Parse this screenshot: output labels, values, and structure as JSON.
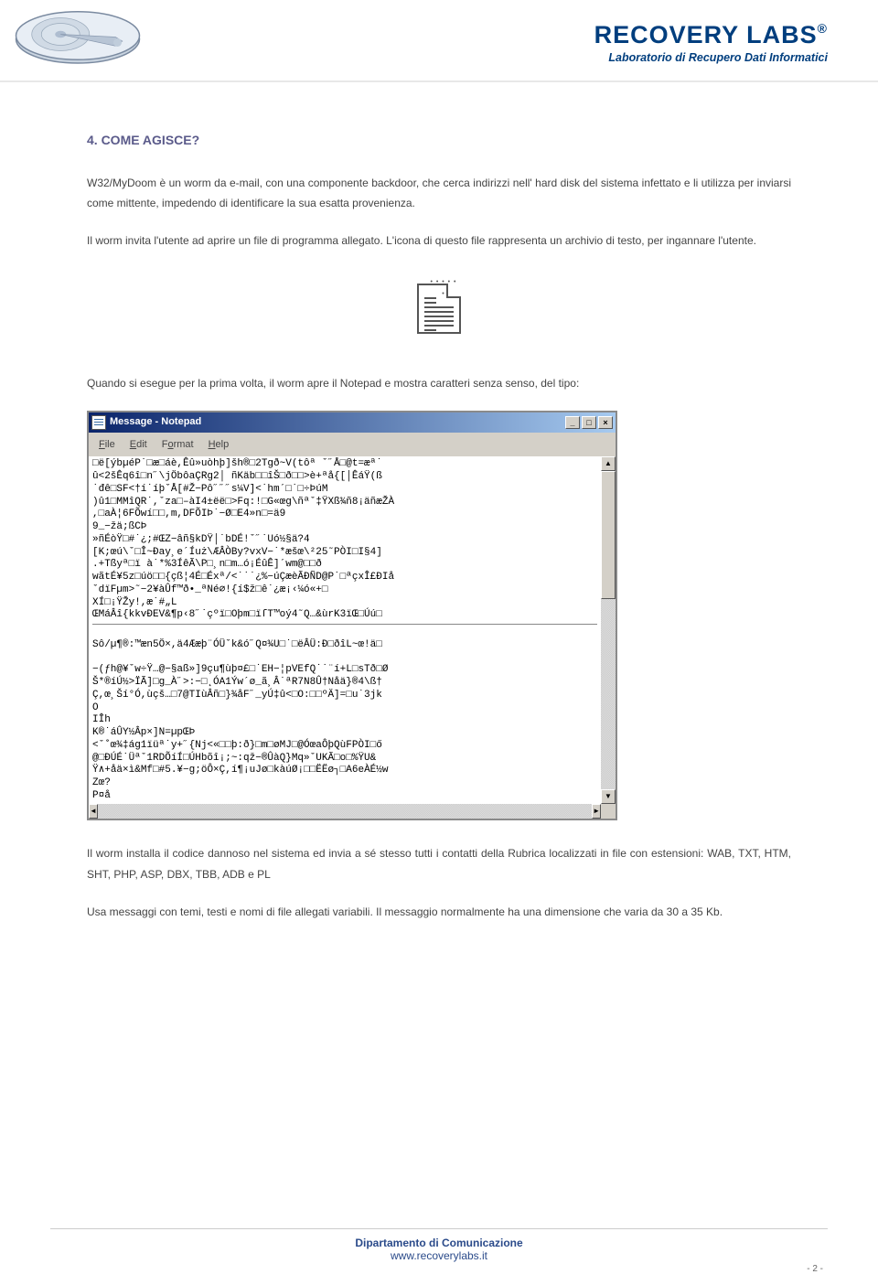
{
  "brand": {
    "name": "RECOVERY LABS",
    "tagline": "Laboratorio di Recupero Dati Informatici"
  },
  "section_title": "4. COME AGISCE?",
  "para1": "W32/MyDoom è un worm da e-mail, con una componente backdoor, che cerca indirizzi nell' hard disk del sistema infettato e li utilizza per inviarsi come mittente, impedendo di identificare la sua esatta provenienza.",
  "para2": "Il worm invita l'utente ad aprire un file di programma allegato. L'icona di questo file rappresenta un archivio di testo, per ingannare l'utente.",
  "para3": "Quando si esegue per la prima volta, il worm apre il Notepad e mostra caratteri senza senso, del tipo:",
  "notepad": {
    "title": "Message - Notepad",
    "menu": {
      "file": "File",
      "edit": "Edit",
      "format": "Format",
      "help": "Help"
    },
    "body": "□ë[ýbµéP˙□æ□áè,Êû»uòhþ]šh®□2Tgð~V(tôª ˇ˝Å□@t=æª˙\nû<2šÊq6î□n˝\\jÖbôaÇRg2│ ñKäb□□îŠ□ð□□>è+ªå{[│ÊáŸ(ß\n˙đê□SF<†í˙íþˇÅ[#Ž−Pô˝˝˝s¼V]<˙hm´□˙□÷ÞúM\n)û1□MMîQR˙,ˇza□–àI4±ëë□>Fq:!□G«œg\\ñªˇ‡ŸXß¾ñ8¡äñæŽÀ\n,□aÀ¦6FÕwí□□,m,DFÕIÞ˙−Ø□E4»n□=ä9\n9_−žä;ßCÞ\n»ñÉòŸ□#˙¿;#ŒZ−âñ§kDŸ│˙bDÉ!ˇ˝˙Uó½§ä?4\n[K;œú\\ˇ□Î~Ðay¸e´Íuż\\ÆÂÒBy?vxV−˙*æšœ\\²25˜PÒI□I§4]\n.+Tßyª□ï à˙*%3ÍêÃ\\P□¸n□m…ó¡ÉûÊ]´wm@□□ð\nwãtÉ¥5z□úö□□{çß¦4É□Éxª/<˙˙˙¿%−úÇæèÃĐÑD@P˙□ªçxÎ£ÐIå\nˇdïFµm>˜−2¥àÛf™ð•_ªNé⌀!{í$ž□ê˙¿æ¡‹¼ó«+□\nXÍ□¡ŸŽy!,æ˙#„L\nŒMáÂî{kkvÐEV&¶p‹8˝˙çºï□Oþm□ïſT™oý4˜Q…&ùrK3ïŒ□Úú□",
    "body2": "Sô/µ¶®:™æn5Ö×,ä4Ææþ¨ÓÜˇk&ó˝Q¤¾U□˙□ëÂÜ:Ð□ðîL~œ!ä□\n\n−(ƒh@¥ˇw÷Ÿ…@−§aß»]9çu¶ùþ¤£□˙EH−¦pVEfQ˙˙¨í+L□sTð□Ø\nŠ*®íÚ½>ÏÃ]□g_À˝>:−□˛ÓA1Ýw´ø_ã¸Â˙ªR7N8Û†Nåä}®4\\ß†\nÇ,œ¸Ší°Ó,ùçš…□7@TIùÂñ□}¾åF˝_yÚ‡û<□O:□□ºÄ]=□u˙3jk\nO\nIÎh\nK®˙áÛY½Âp×]N=µpŒÞ\n<ˇ˚œ¾‡ág1ïüª˙y+˝{Nj<«□□þ:ð}□m□øMJ□@ÓœaÔþQùFPÒI□ő\n@□ÐÚÉ˙Üªˇ1RDÕíÍ□ÚHbõî¡;~:qž−®ÛàQ}Mq»ˇUKÃ□o□%ŸU&\nŸ∧+åä×ì&Mf□#5.¥−g;öÔ×Ç,í¶¡uJø□kàúØ¡□□ËËø┐□A6eÀÉ½w\nZœ?\nP¤å"
  },
  "para4": "Il worm installa il codice dannoso nel sistema ed invia a sé stesso tutti i contatti della Rubrica localizzati in file con estensioni: WAB, TXT, HTM, SHT, PHP, ASP, DBX, TBB, ADB e PL",
  "para5": "Usa messaggi con temi, testi e nomi di file allegati variabili. Il messaggio normalmente ha una dimensione che varia da 30 a 35 Kb.",
  "footer": {
    "dept": "Dipartamento di Comunicazione",
    "url": "www.recoverylabs.it"
  },
  "page_number": "- 2 -"
}
